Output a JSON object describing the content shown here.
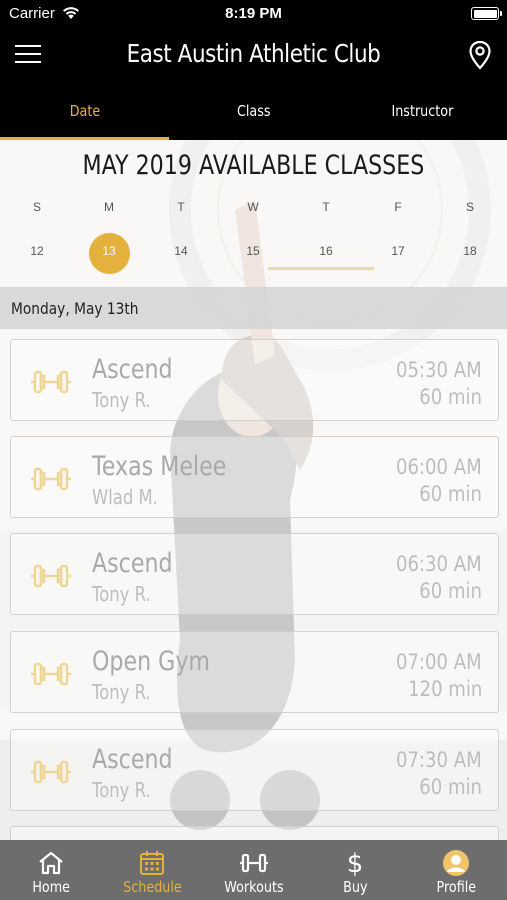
{
  "status_bar": {
    "carrier": "Carrier",
    "time": "8:19 PM"
  },
  "header": {
    "title": "East Austin Athletic Club"
  },
  "tabs": [
    {
      "label": "Date",
      "active": true
    },
    {
      "label": "Class",
      "active": false
    },
    {
      "label": "Instructor",
      "active": false
    }
  ],
  "calendar": {
    "title": "MAY 2019 AVAILABLE CLASSES",
    "days": [
      {
        "letter": "S",
        "num": "12"
      },
      {
        "letter": "M",
        "num": "13",
        "selected": true
      },
      {
        "letter": "T",
        "num": "14"
      },
      {
        "letter": "W",
        "num": "15"
      },
      {
        "letter": "T",
        "num": "16"
      },
      {
        "letter": "F",
        "num": "17"
      },
      {
        "letter": "S",
        "num": "18"
      }
    ]
  },
  "schedule": {
    "date_header": "Monday, May 13th",
    "classes": [
      {
        "name": "Ascend",
        "instructor": "Tony R.",
        "time": "05:30 AM",
        "duration": "60 min"
      },
      {
        "name": "Texas Melee",
        "instructor": "Wlad M.",
        "time": "06:00 AM",
        "duration": "60 min"
      },
      {
        "name": "Ascend",
        "instructor": "Tony R.",
        "time": "06:30 AM",
        "duration": "60 min"
      },
      {
        "name": "Open Gym",
        "instructor": "Tony R.",
        "time": "07:00 AM",
        "duration": "120 min"
      },
      {
        "name": "Ascend",
        "instructor": "Tony R.",
        "time": "07:30 AM",
        "duration": "60 min"
      }
    ]
  },
  "bottom_nav": [
    {
      "label": "Home",
      "icon": "home-icon",
      "active": false
    },
    {
      "label": "Schedule",
      "icon": "calendar-icon",
      "active": true
    },
    {
      "label": "Workouts",
      "icon": "dumbbell-icon",
      "active": false
    },
    {
      "label": "Buy",
      "icon": "dollar-icon",
      "active": false
    },
    {
      "label": "Profile",
      "icon": "user-avatar-icon",
      "active": false
    }
  ],
  "colors": {
    "accent": "#e4b13d",
    "nav_bg": "#6d6d6d",
    "header_bg": "#000000"
  }
}
